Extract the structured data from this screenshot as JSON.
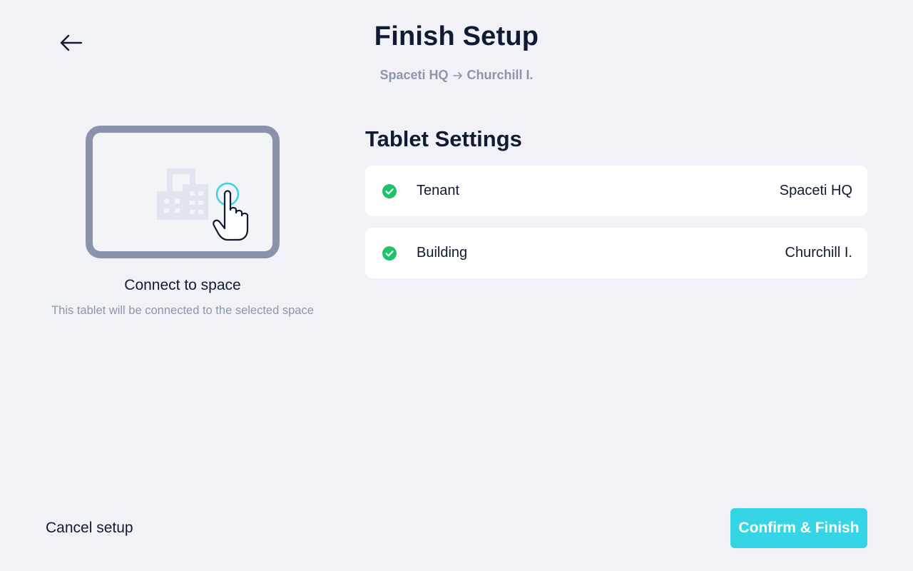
{
  "header": {
    "back_icon": "arrow-left-icon",
    "title": "Finish Setup",
    "breadcrumb": {
      "from": "Spaceti HQ",
      "separator_icon": "arrow-right-icon",
      "to": "Churchill I."
    }
  },
  "left_panel": {
    "illustration_icon": "tablet-building-tap-icon",
    "title": "Connect to space",
    "description": "This tablet will be connected to the selected space"
  },
  "settings": {
    "title": "Tablet Settings",
    "items": [
      {
        "label": "Tenant",
        "value": "Spaceti HQ",
        "status_icon": "check-circle-icon"
      },
      {
        "label": "Building",
        "value": "Churchill I.",
        "status_icon": "check-circle-icon"
      }
    ]
  },
  "footer": {
    "cancel_label": "Cancel setup",
    "confirm_label": "Confirm & Finish"
  },
  "colors": {
    "background": "#f0f2f7",
    "text_primary": "#0f1a33",
    "text_muted": "#8c96ab",
    "success": "#1ec26b",
    "accent": "#36d5e6",
    "card": "#ffffff"
  }
}
